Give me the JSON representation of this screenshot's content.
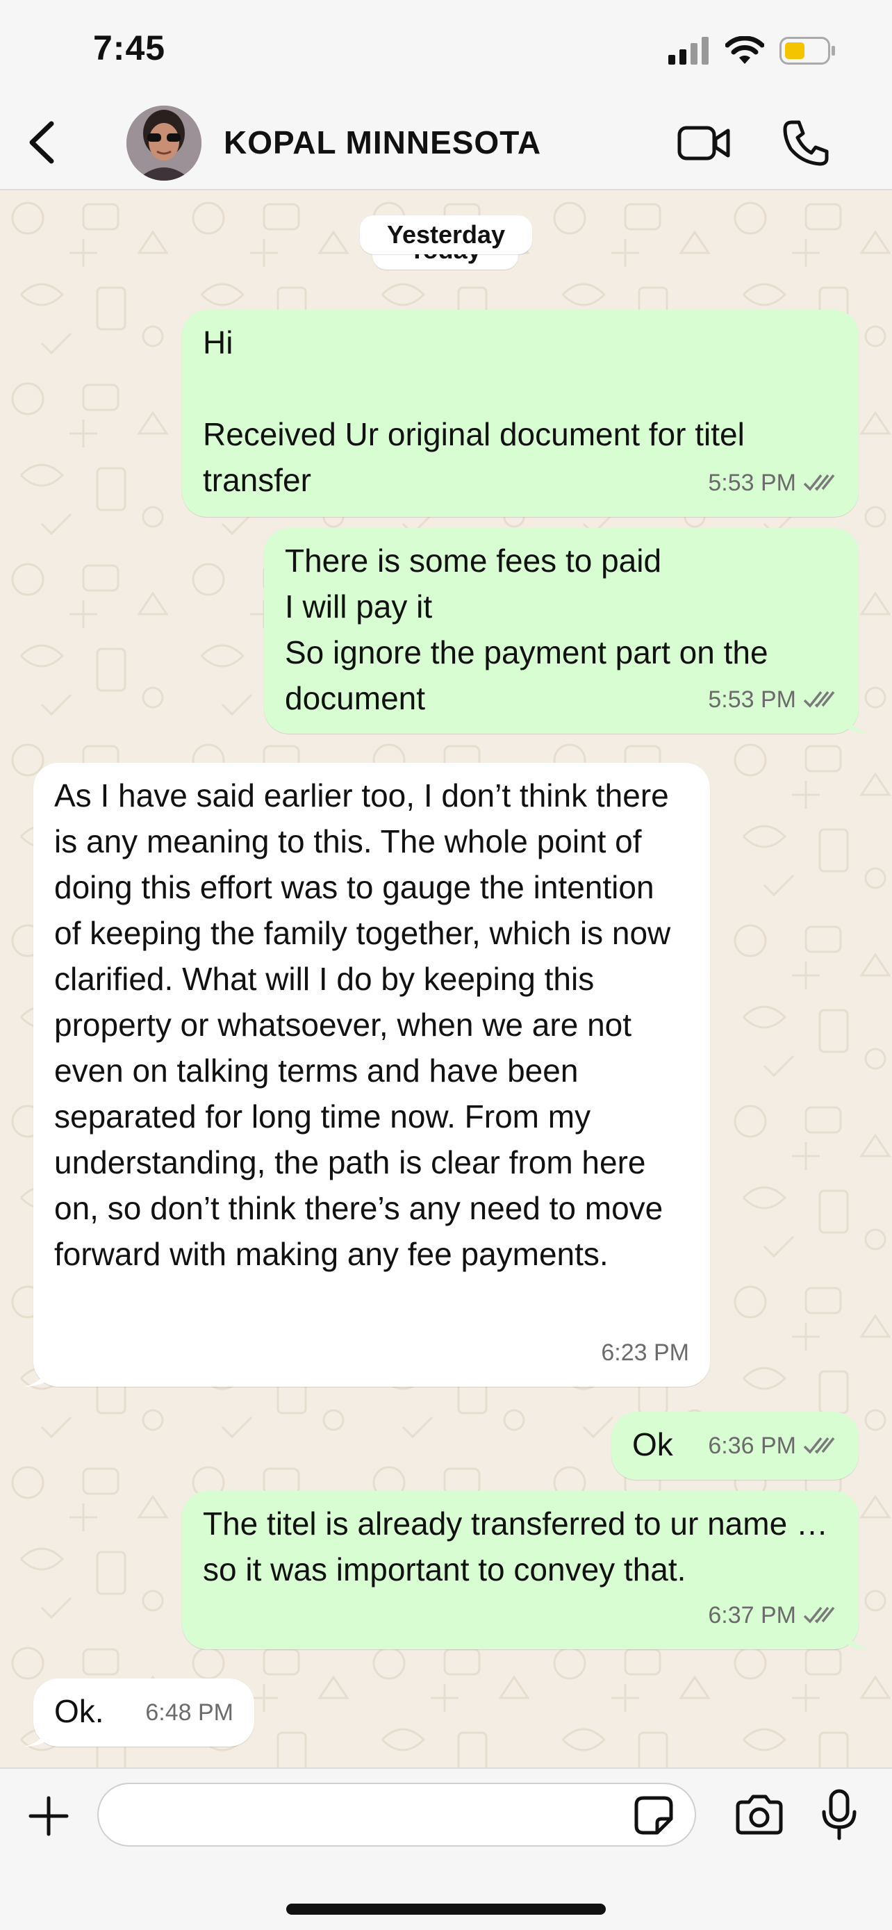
{
  "status_bar": {
    "time": "7:45"
  },
  "header": {
    "contact_name": "KOPAL MINNESOTA"
  },
  "date_chips": {
    "yesterday": "Yesterday",
    "today": "Today"
  },
  "messages": [
    {
      "direction": "out",
      "text": "Hi\n\nReceived Ur original document for titel transfer",
      "time": "5:53 PM"
    },
    {
      "direction": "out",
      "text": "There is some fees to paid\nI will pay it\nSo ignore the payment part on the document",
      "time": "5:53 PM"
    },
    {
      "direction": "in",
      "text": "As I have said earlier too, I don’t think there is any meaning to this. The whole point of doing this effort was to gauge the intention of keeping the family together, which is now clarified. What will I do by keeping this property or whatsoever, when we are not even on talking terms and have been separated for long time now. From my understanding, the path is clear from here on, so don’t think there’s any need to move forward with making any fee payments.",
      "time": "6:23 PM"
    },
    {
      "direction": "out",
      "text": "Ok",
      "time": "6:36 PM"
    },
    {
      "direction": "out",
      "text": "The titel is already transferred to ur name … so it was important to convey that.",
      "time": "6:37 PM"
    },
    {
      "direction": "in",
      "text": "Ok.",
      "time": "6:48 PM"
    }
  ],
  "input": {
    "value": "",
    "placeholder": ""
  },
  "colors": {
    "outgoing_bubble": "#d8fdd2",
    "incoming_bubble": "#ffffff",
    "chat_background": "#f3ede3",
    "read_ticks": "#7a7a7a"
  }
}
